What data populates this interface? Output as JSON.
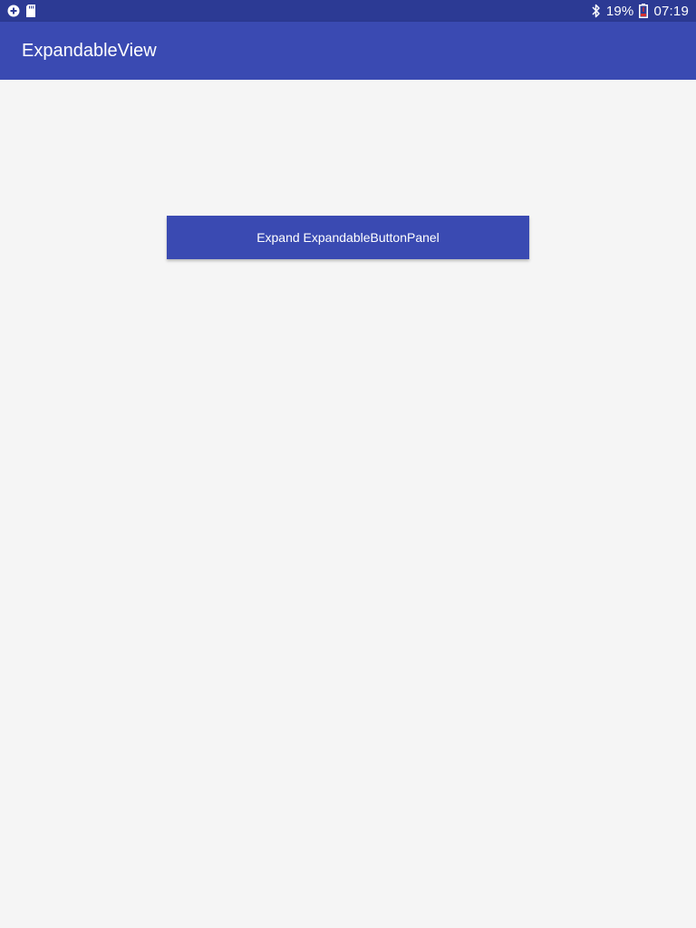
{
  "status_bar": {
    "icons_left": [
      "plus-circle-icon",
      "sd-card-icon"
    ],
    "bluetooth_icon": "bluetooth-icon",
    "battery_percent": "19%",
    "battery_icon": "battery-low-icon",
    "time": "07:19"
  },
  "app_bar": {
    "title": "ExpandableView"
  },
  "main": {
    "expand_button_label": "Expand ExpandableButtonPanel"
  },
  "colors": {
    "primary": "#3a4ab2",
    "primary_dark": "#2c3a94",
    "background": "#f5f5f5",
    "battery_alert": "#d32f2f"
  }
}
